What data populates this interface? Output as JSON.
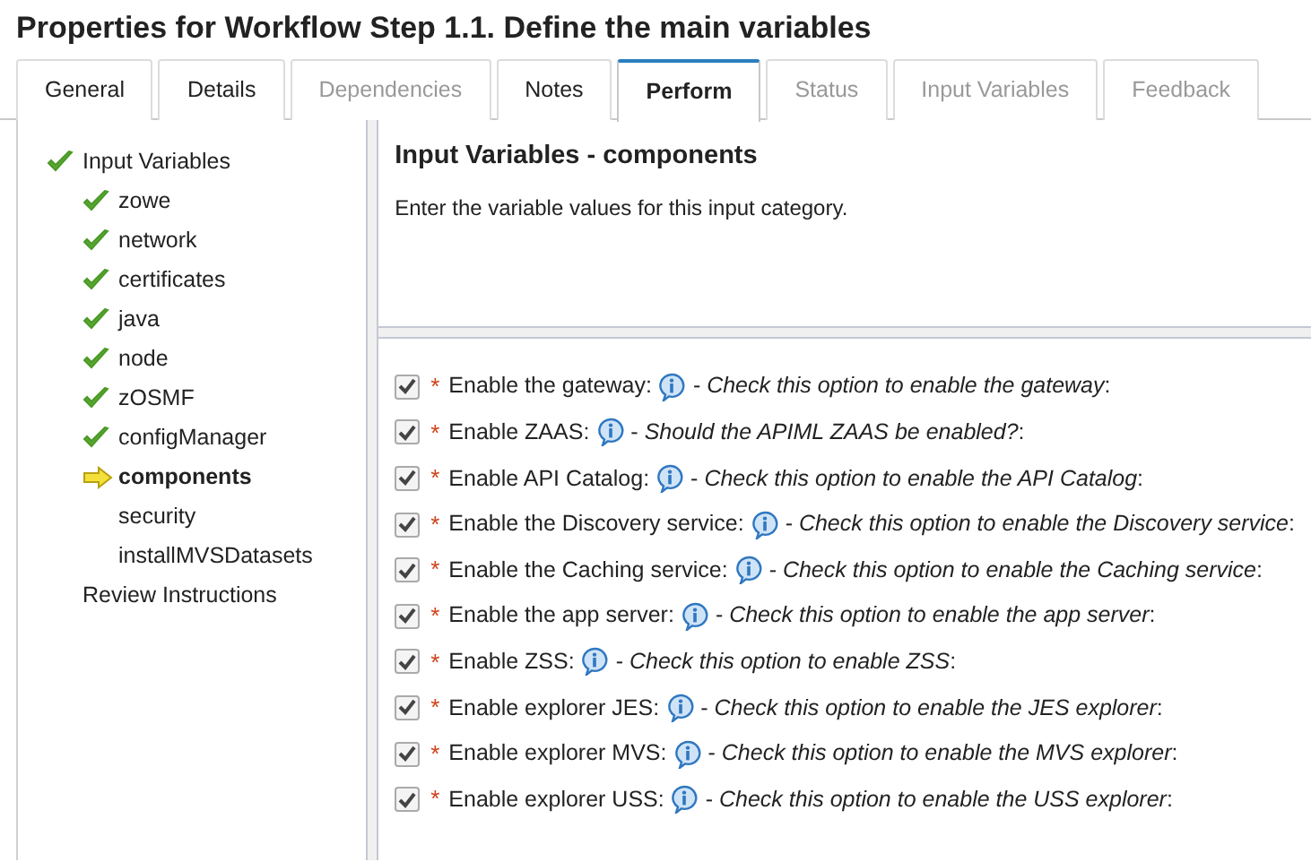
{
  "title": "Properties for Workflow Step 1.1. Define the main variables",
  "tabs": [
    {
      "label": "General",
      "selected": false,
      "disabled": false
    },
    {
      "label": "Details",
      "selected": false,
      "disabled": false
    },
    {
      "label": "Dependencies",
      "selected": false,
      "disabled": true
    },
    {
      "label": "Notes",
      "selected": false,
      "disabled": false
    },
    {
      "label": "Perform",
      "selected": true,
      "disabled": false
    },
    {
      "label": "Status",
      "selected": false,
      "disabled": true
    },
    {
      "label": "Input Variables",
      "selected": false,
      "disabled": true
    },
    {
      "label": "Feedback",
      "selected": false,
      "disabled": true
    }
  ],
  "tree": [
    {
      "label": "Input Variables",
      "kind": "done",
      "selected": false,
      "children": [
        {
          "label": "zowe",
          "kind": "done",
          "selected": false
        },
        {
          "label": "network",
          "kind": "done",
          "selected": false
        },
        {
          "label": "certificates",
          "kind": "done",
          "selected": false
        },
        {
          "label": "java",
          "kind": "done",
          "selected": false
        },
        {
          "label": "node",
          "kind": "done",
          "selected": false
        },
        {
          "label": "zOSMF",
          "kind": "done",
          "selected": false
        },
        {
          "label": "configManager",
          "kind": "done",
          "selected": false
        },
        {
          "label": "components",
          "kind": "current",
          "selected": true
        },
        {
          "label": "security",
          "kind": "plain",
          "selected": false
        },
        {
          "label": "installMVSDatasets",
          "kind": "plain",
          "selected": false
        }
      ]
    },
    {
      "label": "Review Instructions",
      "kind": "plain",
      "selected": false
    }
  ],
  "heading": "Input Variables - components",
  "intro": "Enter the variable values for this input category.",
  "options": [
    {
      "checked": true,
      "required_mark": "*",
      "label": "Enable the gateway:",
      "description": "- *Check this option to enable the gateway*:"
    },
    {
      "checked": true,
      "required_mark": "*",
      "label": "Enable ZAAS:",
      "description": "- *Should the APIML ZAAS be enabled?*:"
    },
    {
      "checked": true,
      "required_mark": "*",
      "label": "Enable API Catalog:",
      "description": "- *Check this option to enable the API Catalog*:"
    },
    {
      "checked": true,
      "required_mark": "*",
      "label": "Enable the Discovery service:",
      "description": "- *Check this option to enable the Discovery service*:"
    },
    {
      "checked": true,
      "required_mark": "*",
      "label": "Enable the Caching service:",
      "description": "- *Check this option to enable the Caching service*:"
    },
    {
      "checked": true,
      "required_mark": "*",
      "label": "Enable the app server:",
      "description": "- *Check this option to enable the app server*:"
    },
    {
      "checked": true,
      "required_mark": "*",
      "label": "Enable ZSS:",
      "description": "- *Check this option to enable ZSS*:"
    },
    {
      "checked": true,
      "required_mark": "*",
      "label": "Enable explorer JES:",
      "description": "- *Check this option to enable the JES explorer*:"
    },
    {
      "checked": true,
      "required_mark": "*",
      "label": "Enable explorer MVS:",
      "description": "- *Check this option to enable the MVS explorer*:"
    },
    {
      "checked": true,
      "required_mark": "*",
      "label": "Enable explorer USS:",
      "description": "- *Check this option to enable the USS explorer*:"
    }
  ]
}
